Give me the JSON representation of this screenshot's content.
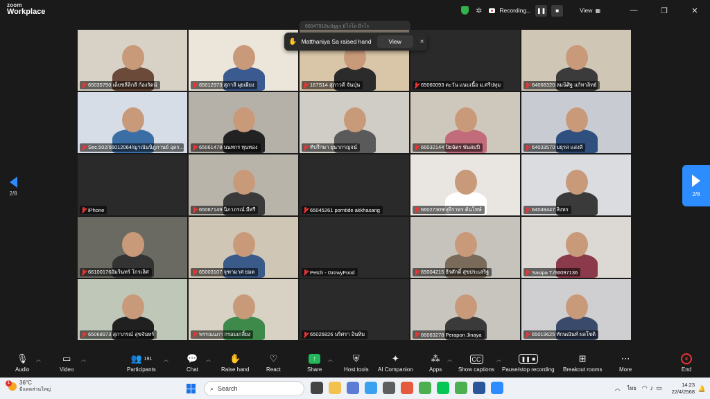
{
  "app": {
    "logo_top": "zoom",
    "logo_bottom": "Workplace"
  },
  "topbar": {
    "recording_label": "Recording...",
    "view_label": "View",
    "view_icon": "grid-icon",
    "pause_icon": "pause-icon",
    "stop_icon": "stop-icon"
  },
  "toast": {
    "ghost_text": "65047918นนัฐฐรุ มิโรโล มีรโร",
    "message": "Matthaniya Sa raised hand",
    "view_button": "View",
    "close": "×"
  },
  "pagination": {
    "left": "2/8",
    "right": "2/8"
  },
  "tiles": [
    {
      "name": "65035750 เด็ยชลีลิกลี ก้องรัดน์"
    },
    {
      "name": "65012973 สุภาลี ผุยเผียง"
    },
    {
      "name": "167S14 สุภาวดี จันปุ่น"
    },
    {
      "name": "65060093 ตะวัน แนบเนื้อ ม.ศรีปทุม"
    },
    {
      "name": "64068320 ลมนิศิฐ แก้ทาลิทย์"
    },
    {
      "name": "Sec.502/66012064/ญาณันนิฎกานย์ อุดร..."
    },
    {
      "name": "65061478 นนทกร หุนทอง"
    },
    {
      "name": "ทีปรึกษา ยุนากาญจน์"
    },
    {
      "name": "66032144 ปิยฉัตร พันสมปี"
    },
    {
      "name": "64033570 มธุรส แสงลี"
    },
    {
      "name": "iPhone"
    },
    {
      "name": "65067149 นิภาภรณ์ มีศรี"
    },
    {
      "name": "65045261 porntide akkhasang"
    },
    {
      "name": "66027309/สุจิราพร ต้นโทษ์"
    },
    {
      "name": "64049447 สิงหร"
    },
    {
      "name": "66100176อัมรินทร์ โกรเลิศ"
    },
    {
      "name": "65003107 จุฑามาศ ยมต"
    },
    {
      "name": "Petch - GrowyFood"
    },
    {
      "name": "65004215 ธีรศักดิ์ สุขประเสริฐ"
    },
    {
      "name": "Sasipa T./66097136"
    },
    {
      "name": "65068973 สุภาภรณ์ สุขจันทร์"
    },
    {
      "name": "พรรณนภา กรอมเกลี้ยง"
    },
    {
      "name": "65026826 นริศรา อินทิม"
    },
    {
      "name": "66063278 Perapon Jinaya"
    },
    {
      "name": "65019625 ทักษณันท์ ผลโชติ"
    }
  ],
  "toolbar": {
    "audio": "Audio",
    "video": "Video",
    "participants": "Participants",
    "participants_count": "191",
    "chat": "Chat",
    "raise_hand": "Raise hand",
    "react": "React",
    "share": "Share",
    "host_tools": "Host tools",
    "ai_companion": "AI Companion",
    "apps": "Apps",
    "captions": "Show captions",
    "recording": "Pause/stop recording",
    "breakout": "Breakout rooms",
    "more": "More",
    "end": "End"
  },
  "taskbar": {
    "temp": "36°C",
    "weather_text": "มีแดดส่วนใหญ่",
    "notif_count": "1",
    "search_placeholder": "Search",
    "lang": "ไทย",
    "time": "14:23",
    "date": "22/4/2568"
  }
}
